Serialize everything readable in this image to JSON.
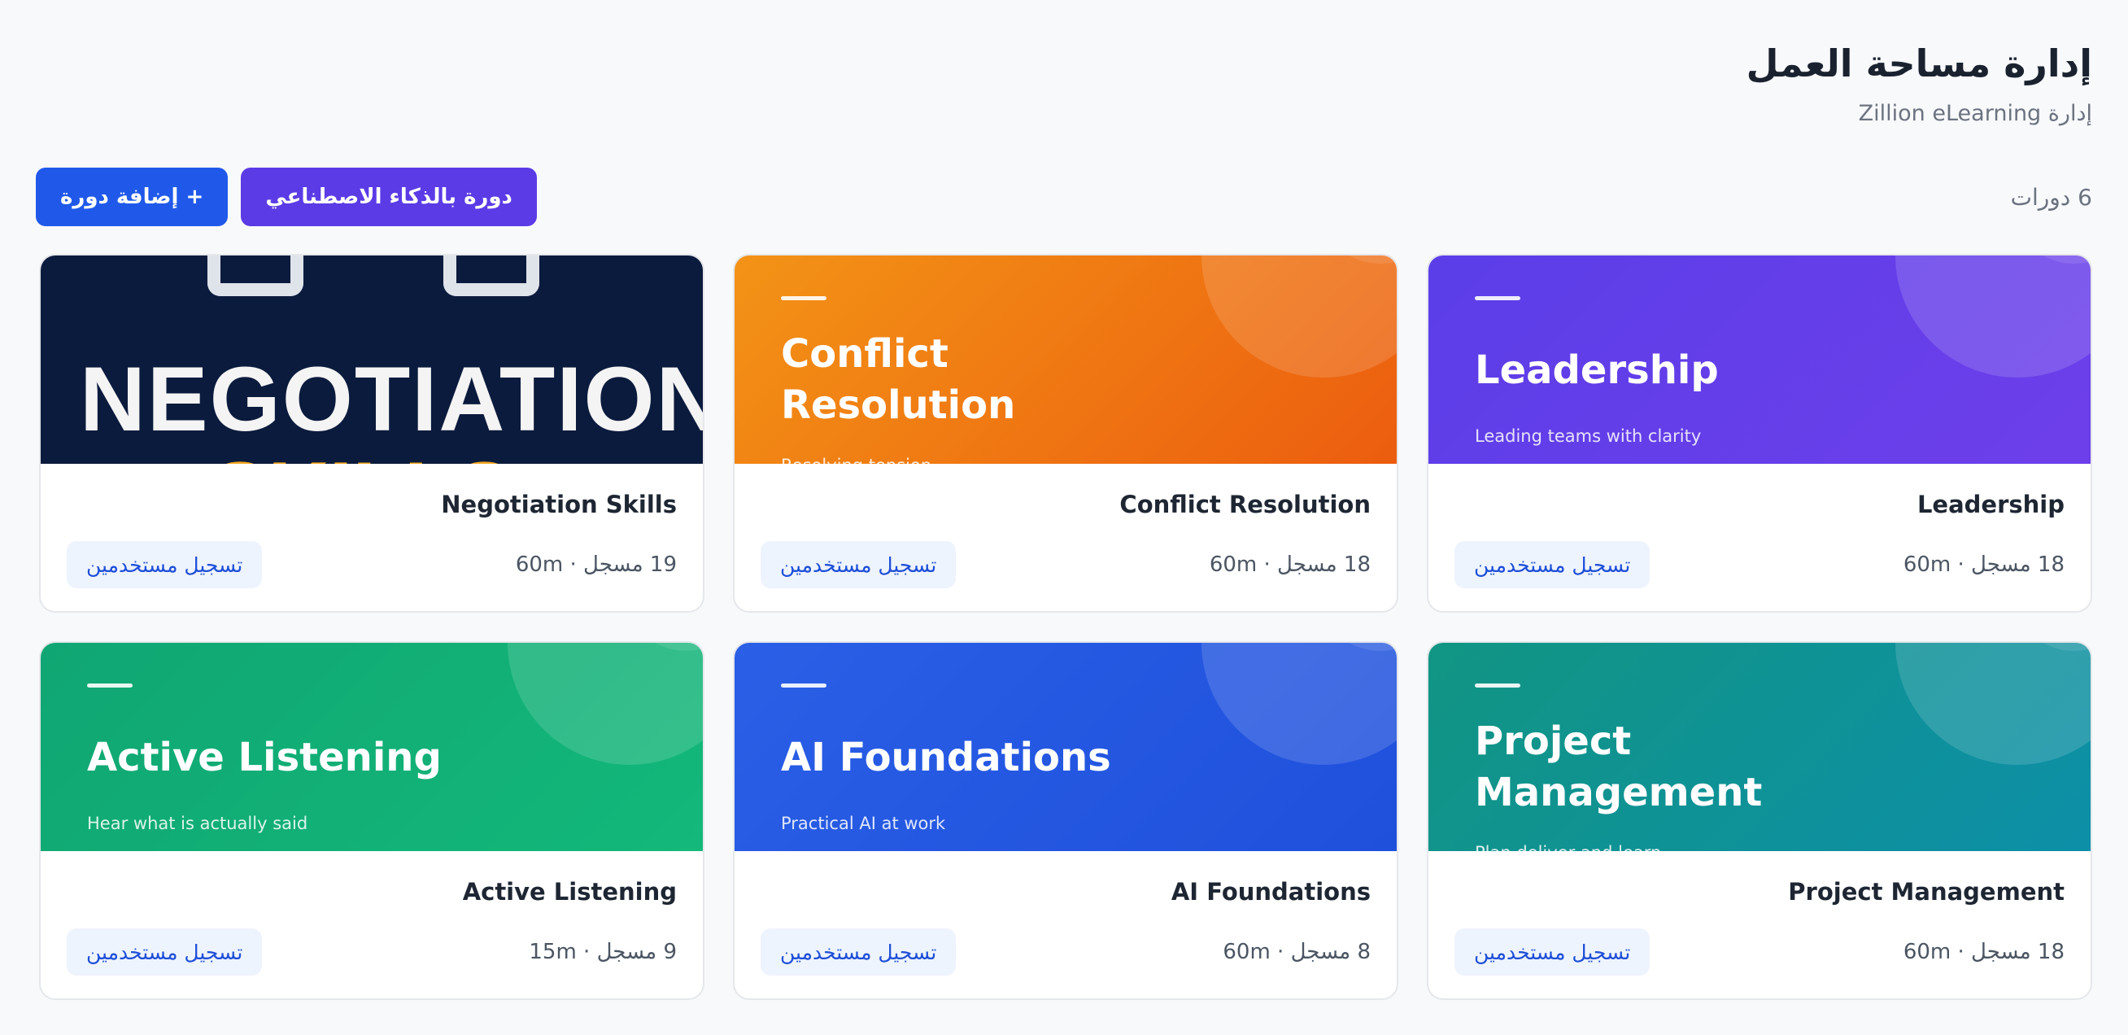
{
  "header": {
    "title": "إدارة مساحة العمل",
    "subtitle": "إدارة Zillion eLearning"
  },
  "toolbar": {
    "course_count": "6 دورات",
    "ai_button_label": "دورة بالذكاء الاصطناعي",
    "add_button_label": "+ إضافة دورة"
  },
  "colors": {
    "primary": "#2059ea",
    "ai": "#5b3be6",
    "enroll_bg": "#eef4fe",
    "enroll_text": "#1d4ed8"
  },
  "courses": [
    {
      "cover_title_lines": [
        "Leadership"
      ],
      "cover_tagline": "Leading teams with clarity",
      "name": "Leadership",
      "meta": "18 مسجل · 60m",
      "enroll_label": "تسجيل مستخدمين",
      "cover_color": "purple"
    },
    {
      "cover_title_lines": [
        "Conflict",
        "Resolution"
      ],
      "cover_tagline": "Resolving tension",
      "name": "Conflict Resolution",
      "meta": "18 مسجل · 60m",
      "enroll_label": "تسجيل مستخدمين",
      "cover_color": "orange"
    },
    {
      "cover_image_text": [
        "NEGOTIATION",
        "SKILLS"
      ],
      "name": "Negotiation Skills",
      "meta": "19 مسجل · 60m",
      "enroll_label": "تسجيل مستخدمين",
      "cover_color": "navy"
    },
    {
      "cover_title_lines": [
        "Project",
        "Management"
      ],
      "cover_tagline": "Plan deliver and learn",
      "name": "Project Management",
      "meta": "18 مسجل · 60m",
      "enroll_label": "تسجيل مستخدمين",
      "cover_color": "teal"
    },
    {
      "cover_title_lines": [
        "AI Foundations"
      ],
      "cover_tagline": "Practical AI at work",
      "name": "AI Foundations",
      "meta": "8 مسجل · 60m",
      "enroll_label": "تسجيل مستخدمين",
      "cover_color": "blue"
    },
    {
      "cover_title_lines": [
        "Active Listening"
      ],
      "cover_tagline": "Hear what is actually said",
      "name": "Active Listening",
      "meta": "9 مسجل · 15m",
      "enroll_label": "تسجيل مستخدمين",
      "cover_color": "green"
    }
  ]
}
